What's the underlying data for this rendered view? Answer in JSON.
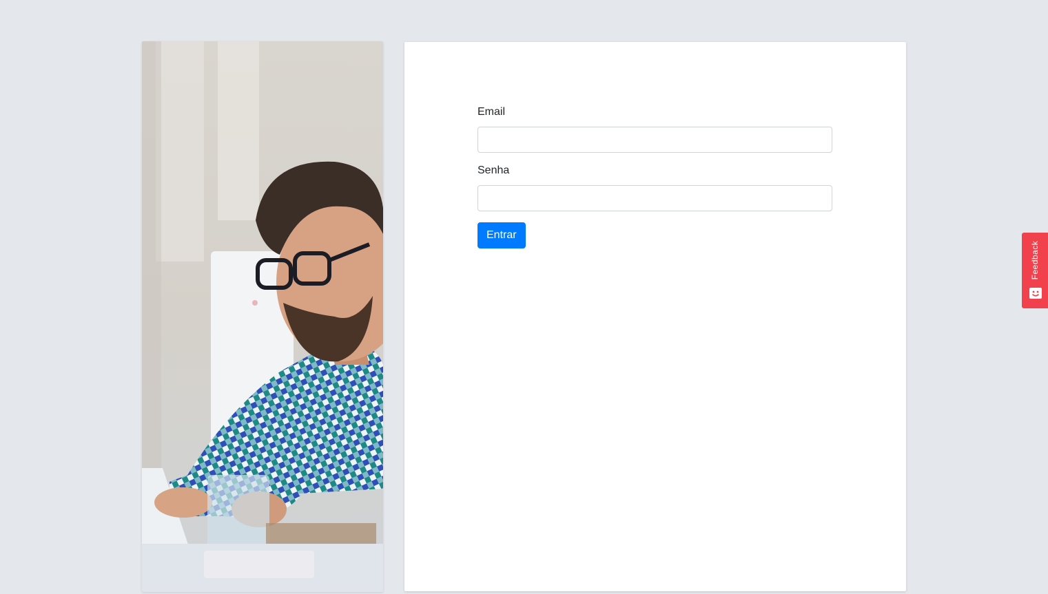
{
  "login_form": {
    "email_label": "Email",
    "email_value": "",
    "password_label": "Senha",
    "password_value": "",
    "submit_label": "Entrar"
  },
  "feedback": {
    "label": "Feedback",
    "icon": "smiley-icon"
  },
  "photo": {
    "icon": "man-at-laptop-photo"
  },
  "colors": {
    "page_background": "#e4e7ec",
    "primary": "#007bff",
    "feedback": "#f0414c"
  }
}
